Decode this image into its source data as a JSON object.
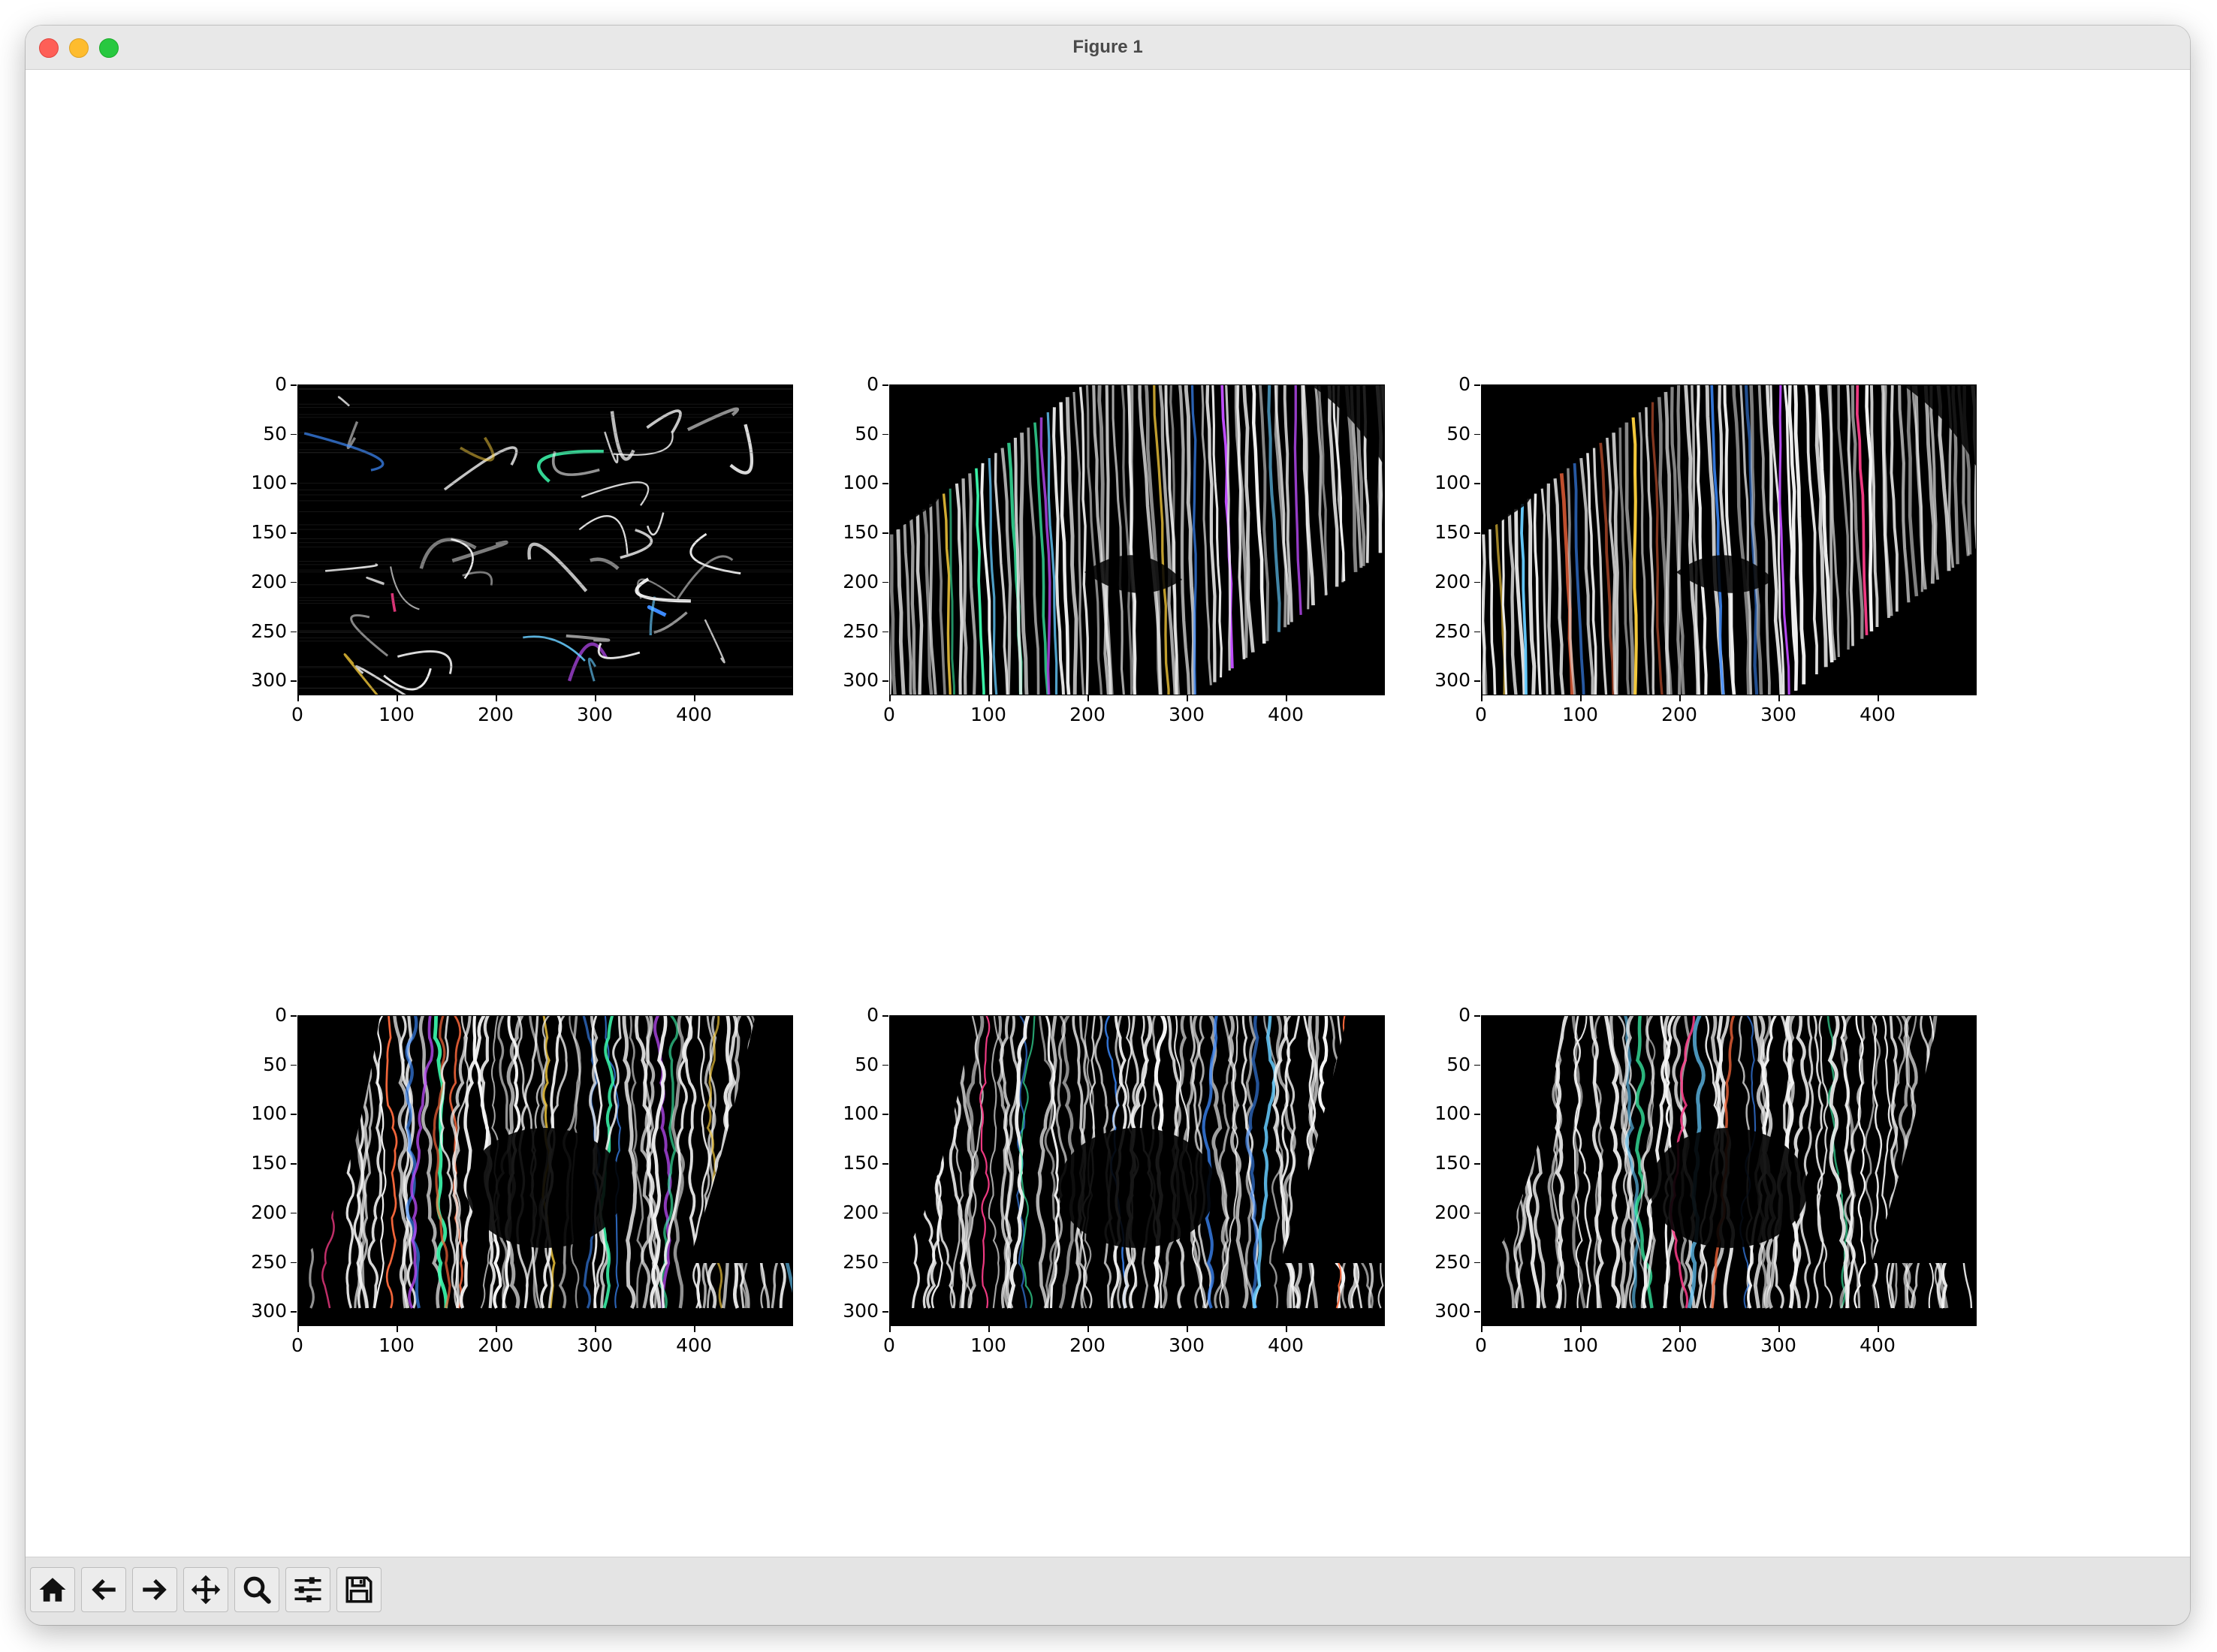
{
  "window": {
    "title": "Figure 1"
  },
  "toolbar": {
    "buttons": [
      {
        "name": "home",
        "icon": "home-icon"
      },
      {
        "name": "back",
        "icon": "arrow-left-icon"
      },
      {
        "name": "forward",
        "icon": "arrow-right-icon"
      },
      {
        "name": "pan",
        "icon": "move-icon"
      },
      {
        "name": "zoom",
        "icon": "magnifier-icon"
      },
      {
        "name": "configure-subplots",
        "icon": "sliders-icon"
      },
      {
        "name": "save",
        "icon": "floppy-disk-icon"
      }
    ]
  },
  "chart_data": [
    {
      "type": "image",
      "title": "",
      "xlabel": "",
      "ylabel": "",
      "xticks": [
        "0",
        "100",
        "200",
        "300",
        "400"
      ],
      "yticks": [
        "0",
        "50",
        "100",
        "150",
        "200",
        "250",
        "300"
      ],
      "xlim": [
        0,
        500
      ],
      "ylim": [
        315,
        0
      ],
      "content": "Gabor-filtered image, fine edge response"
    },
    {
      "type": "image",
      "title": "",
      "xlabel": "",
      "ylabel": "",
      "xticks": [
        "0",
        "100",
        "200",
        "300",
        "400"
      ],
      "yticks": [
        "0",
        "50",
        "100",
        "150",
        "200",
        "250",
        "300"
      ],
      "xlim": [
        0,
        500
      ],
      "ylim": [
        315,
        0
      ],
      "content": "Gabor-filtered image, diagonal stripes"
    },
    {
      "type": "image",
      "title": "",
      "xlabel": "",
      "ylabel": "",
      "xticks": [
        "0",
        "100",
        "200",
        "300",
        "400"
      ],
      "yticks": [
        "0",
        "50",
        "100",
        "150",
        "200",
        "250",
        "300"
      ],
      "xlim": [
        0,
        500
      ],
      "ylim": [
        315,
        0
      ],
      "content": "Gabor-filtered image, diagonal stripes, broader"
    },
    {
      "type": "image",
      "title": "",
      "xlabel": "",
      "ylabel": "",
      "xticks": [
        "0",
        "100",
        "200",
        "300",
        "400"
      ],
      "yticks": [
        "0",
        "50",
        "100",
        "150",
        "200",
        "250",
        "300"
      ],
      "xlim": [
        0,
        500
      ],
      "ylim": [
        315,
        0
      ],
      "content": "Gabor-filtered image, vertical stripes"
    },
    {
      "type": "image",
      "title": "",
      "xlabel": "",
      "ylabel": "",
      "xticks": [
        "0",
        "100",
        "200",
        "300",
        "400"
      ],
      "yticks": [
        "0",
        "50",
        "100",
        "150",
        "200",
        "250",
        "300"
      ],
      "xlim": [
        0,
        500
      ],
      "ylim": [
        315,
        0
      ],
      "content": "Gabor-filtered image, vertical stripes"
    },
    {
      "type": "image",
      "title": "",
      "xlabel": "",
      "ylabel": "",
      "xticks": [
        "0",
        "100",
        "200",
        "300",
        "400"
      ],
      "yticks": [
        "0",
        "50",
        "100",
        "150",
        "200",
        "250",
        "300"
      ],
      "xlim": [
        0,
        500
      ],
      "ylim": [
        315,
        0
      ],
      "content": "Gabor-filtered image, vertical stripes"
    }
  ]
}
